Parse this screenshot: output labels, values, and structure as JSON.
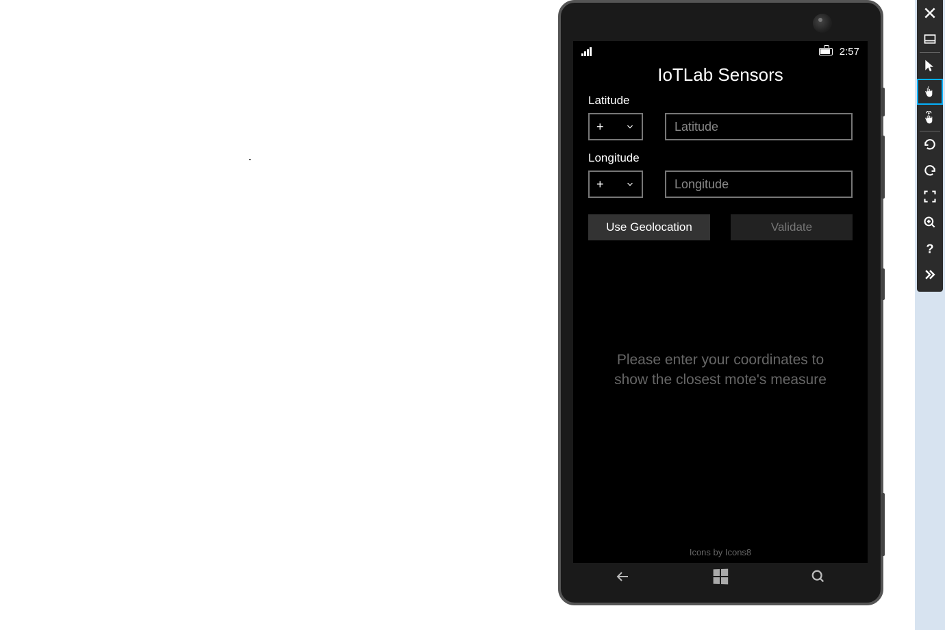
{
  "status_bar": {
    "time": "2:57"
  },
  "app": {
    "title": "IoTLab Sensors"
  },
  "latitude": {
    "label": "Latitude",
    "sign": "+",
    "placeholder": "Latitude"
  },
  "longitude": {
    "label": "Longitude",
    "sign": "+",
    "placeholder": "Longitude"
  },
  "buttons": {
    "geolocation": "Use Geolocation",
    "validate": "Validate"
  },
  "hint": "Please enter your coordinates to show the closest mote's measure",
  "footer": "Icons by Icons8"
}
